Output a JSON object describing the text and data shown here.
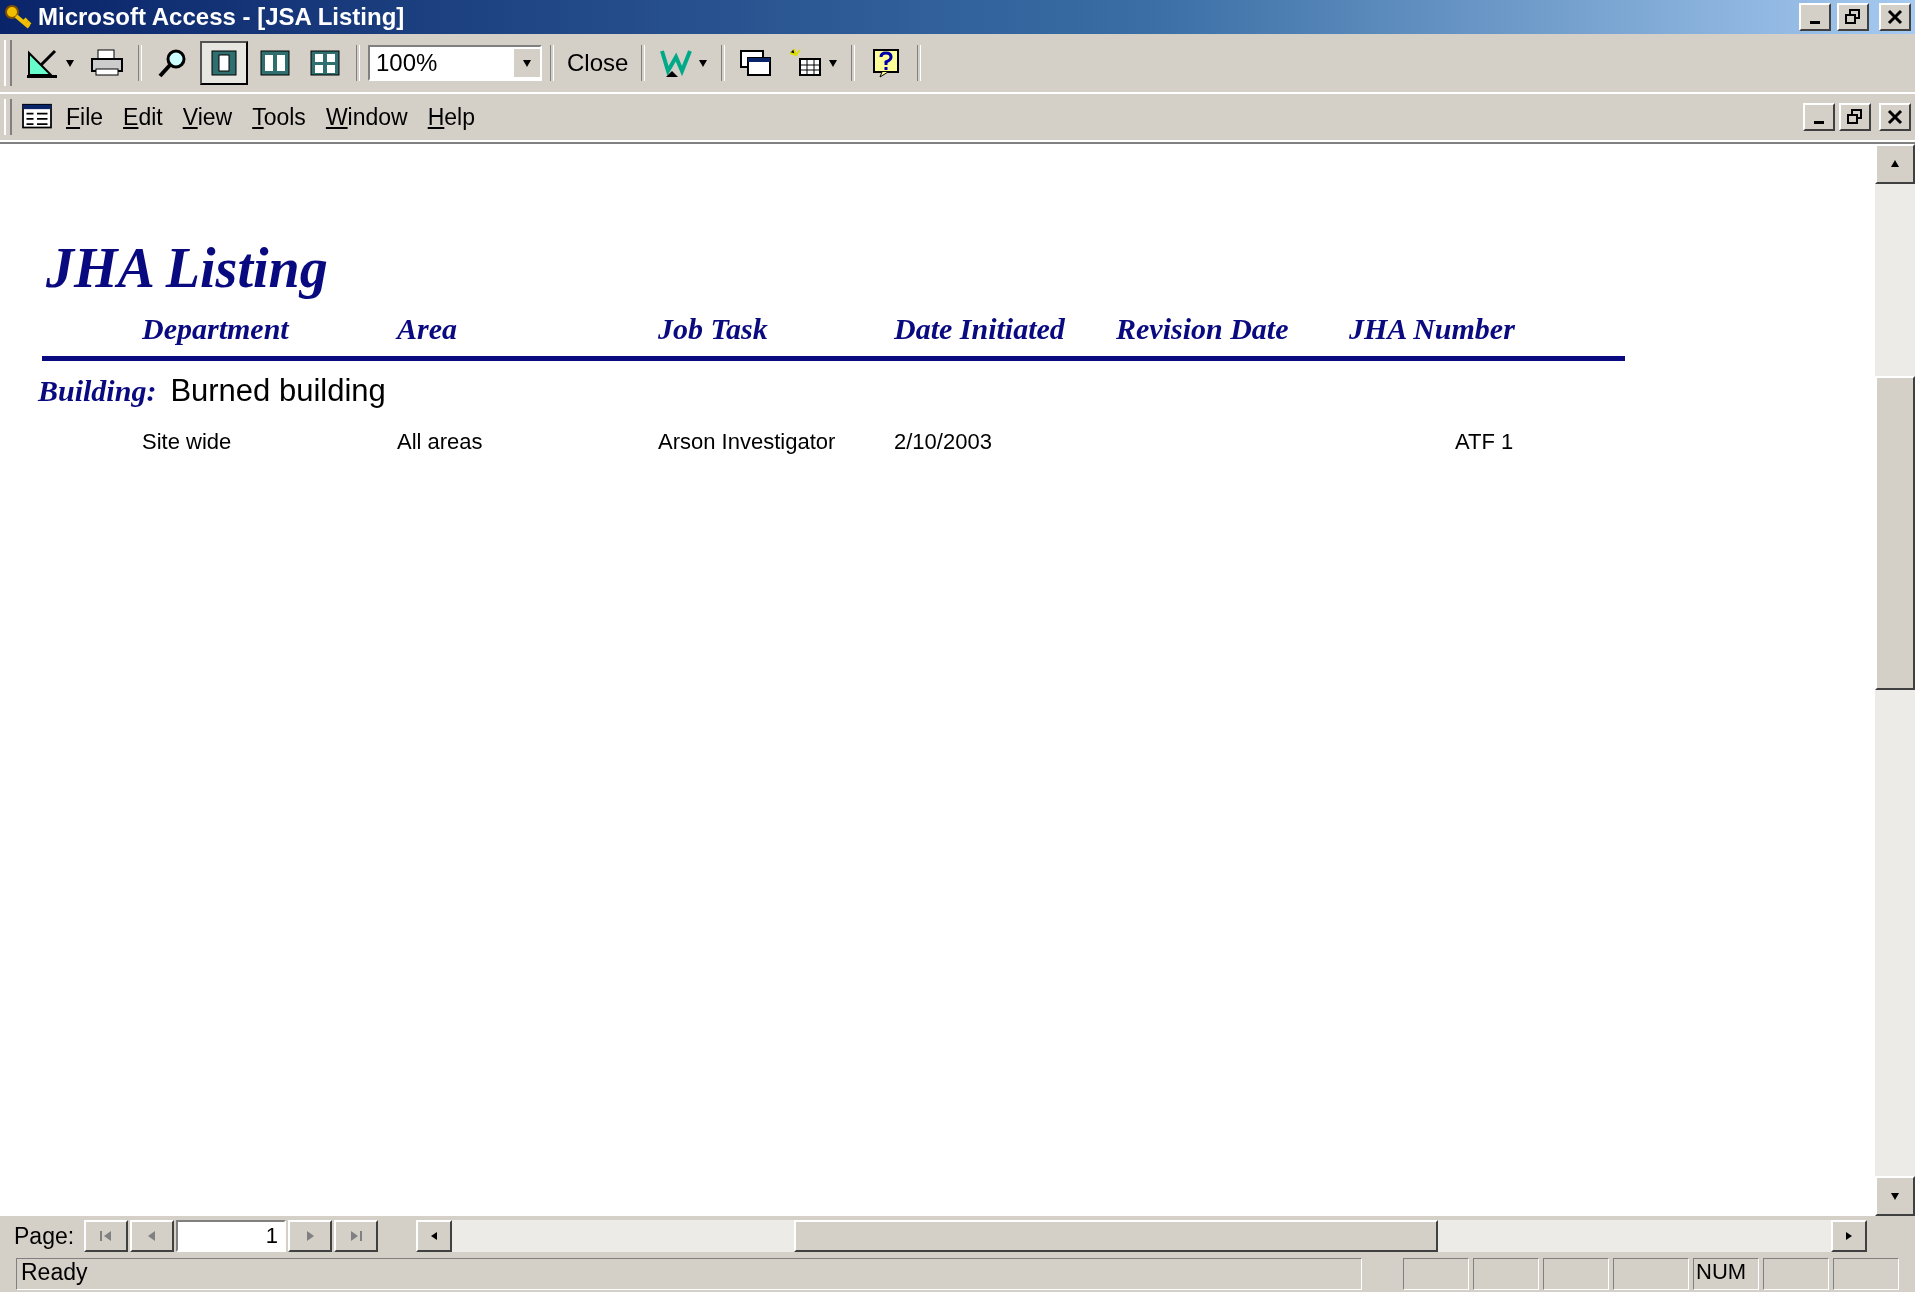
{
  "window": {
    "title": "Microsoft Access - [JSA Listing]"
  },
  "toolbar": {
    "view_buttons": [
      {
        "selected": true
      },
      {
        "selected": false
      },
      {
        "selected": false
      }
    ],
    "zoom": "100%",
    "close": "Close"
  },
  "menu": [
    "File",
    "Edit",
    "View",
    "Tools",
    "Window",
    "Help"
  ],
  "report": {
    "title": "JHA Listing",
    "columns": [
      "Department",
      "Area",
      "Job Task",
      "Date Initiated",
      "Revision Date",
      "JHA Number"
    ],
    "groups": [
      {
        "label": "Building:",
        "value": "Burned building",
        "rows": [
          {
            "cells": [
              "Site wide",
              "All areas",
              "Arson Investigator",
              "2/10/2003",
              null,
              "ATF 1"
            ]
          }
        ]
      }
    ]
  },
  "navigation": {
    "label": "Page:",
    "page": "1"
  },
  "status_bar": {
    "text": "Ready",
    "indicators": [
      {
        "kind": "blank"
      },
      {
        "kind": "blank"
      },
      {
        "kind": "blank"
      },
      {
        "kind": "blank"
      },
      {
        "kind": "text",
        "text": "NUM"
      },
      {
        "kind": "blank"
      },
      {
        "kind": "blank"
      }
    ]
  }
}
